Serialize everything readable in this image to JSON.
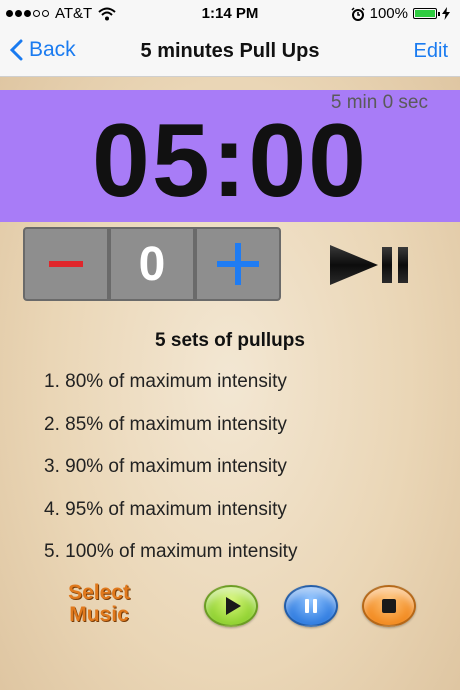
{
  "status_bar": {
    "carrier": "AT&T",
    "time": "1:14 PM",
    "battery": "100%",
    "battery_level": 1.0,
    "icons": [
      "signal-dots-icon",
      "wifi-icon",
      "alarm-icon",
      "battery-icon",
      "charging-bolt-icon"
    ]
  },
  "nav": {
    "back_label": "Back",
    "title": "5 minutes Pull Ups",
    "edit_label": "Edit"
  },
  "timer": {
    "subtitle": "5 min 0 sec",
    "display": "05:00",
    "background_color": "#a87cf7"
  },
  "stepper": {
    "minus_label": "–",
    "value": "0",
    "plus_label": "+"
  },
  "workout": {
    "title": "5 sets of  pullups",
    "sets": [
      "1. 80% of maximum intensity",
      "2. 85% of maximum intensity",
      "3. 90% of maximum intensity",
      "4. 95% of maximum intensity",
      "5. 100% of maximum intensity"
    ]
  },
  "music": {
    "select_label_line1": "Select",
    "select_label_line2": "Music",
    "icons": [
      "play-icon",
      "pause-icon",
      "stop-icon"
    ]
  },
  "colors": {
    "accent": "#1a7bf0",
    "minus": "#e0262b",
    "plus": "#1f7cf3",
    "select_music": "#e0791d"
  }
}
